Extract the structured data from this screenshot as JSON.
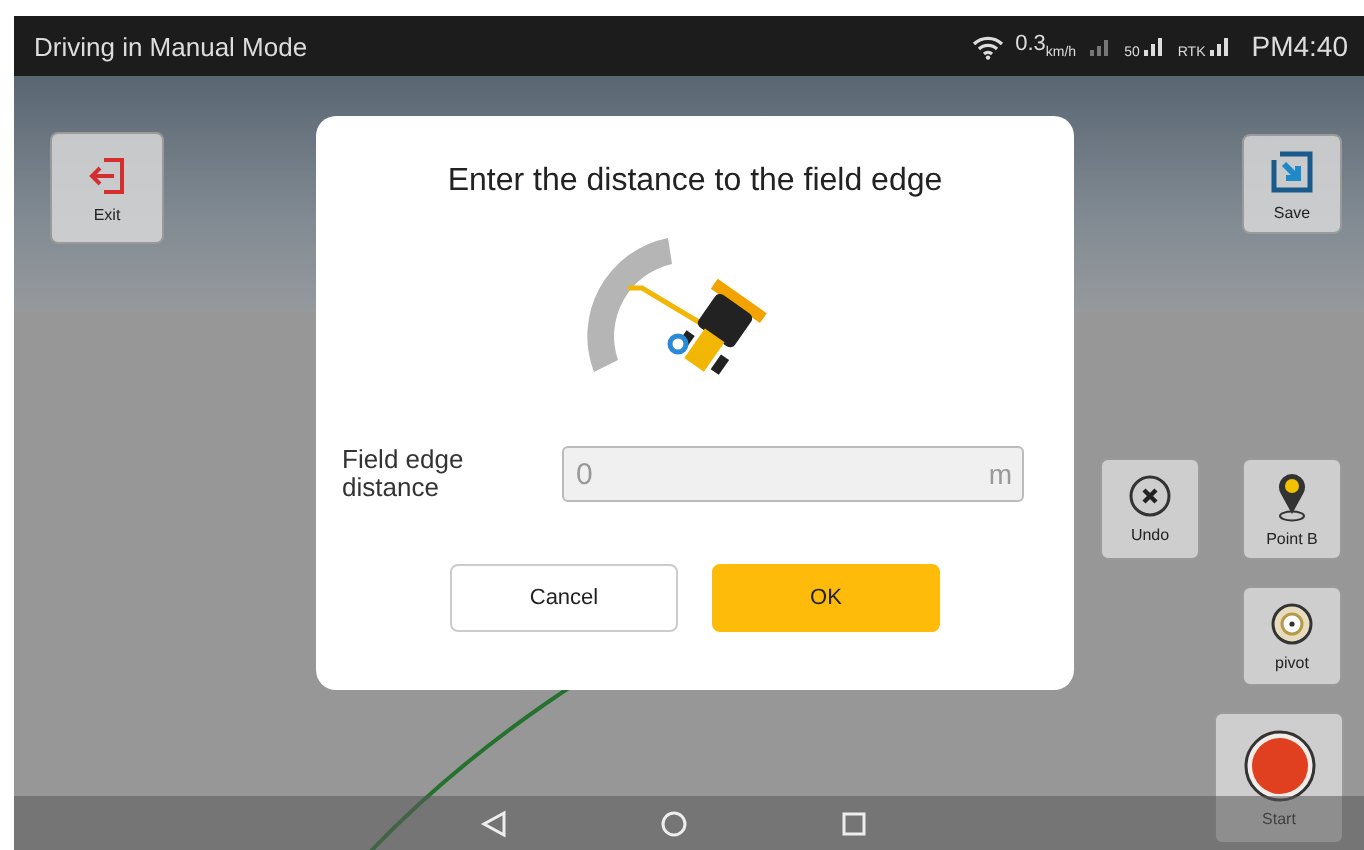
{
  "status_bar": {
    "title": "Driving in Manual Mode",
    "speed": "0.3",
    "speed_unit": "km/h",
    "satellites": "50",
    "rtk_label": "RTK",
    "time": "PM4:40"
  },
  "side_buttons": [
    {
      "label": "Exit",
      "kind": "exit"
    },
    {
      "label": "Save",
      "kind": "save"
    },
    {
      "label": "Undo",
      "kind": "undo"
    },
    {
      "label": "Point B",
      "kind": "point"
    },
    {
      "label": "pivot",
      "kind": "pivot"
    },
    {
      "label": "Start",
      "kind": "start"
    }
  ],
  "dialog": {
    "title": "Enter the distance to the field edge",
    "field_label": "Field edge distance",
    "field_value": "0",
    "unit": "m",
    "buttons": [
      {
        "label": "Cancel",
        "kind": "secondary"
      },
      {
        "label": "OK",
        "kind": "primary"
      }
    ]
  }
}
